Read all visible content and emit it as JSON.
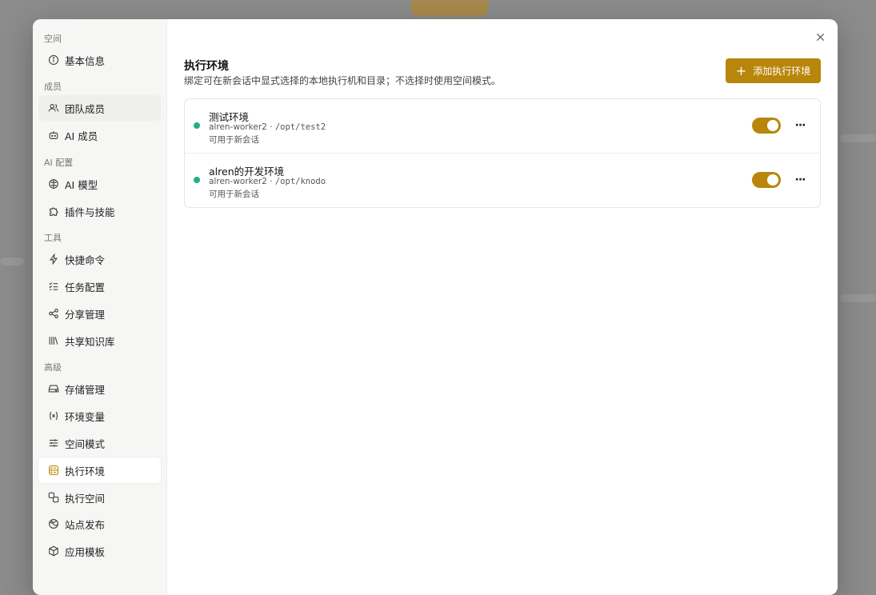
{
  "sidebar": {
    "groups": {
      "space": "空间",
      "members": "成员",
      "ai": "AI 配置",
      "tools": "工具",
      "advanced": "高级"
    },
    "items": {
      "basic_info": "基本信息",
      "team_members": "团队成员",
      "ai_members": "AI 成员",
      "ai_models": "AI 模型",
      "plugins_skills": "插件与技能",
      "shortcuts": "快捷命令",
      "task_config": "任务配置",
      "share_mgmt": "分享管理",
      "shared_kb": "共享知识库",
      "storage_mgmt": "存储管理",
      "env_vars": "环境变量",
      "space_mode": "空间模式",
      "exec_env": "执行环境",
      "exec_space": "执行空间",
      "site_publish": "站点发布",
      "app_templates": "应用模板"
    }
  },
  "main": {
    "title": "执行环境",
    "description": "绑定可在新会话中显式选择的本地执行机和目录；不选择时使用空间模式。",
    "add_button": "添加执行环境",
    "environments": [
      {
        "name": "测试环境",
        "worker": "alren-worker2",
        "separator": " · ",
        "path": "/opt/test2",
        "status": "可用于新会话",
        "enabled": true
      },
      {
        "name": "alren的开发环境",
        "worker": "alren-worker2",
        "separator": " · ",
        "path": "/opt/knodo",
        "status": "可用于新会话",
        "enabled": true
      }
    ]
  },
  "colors": {
    "accent": "#b8860b",
    "status_online": "#1fb37a"
  }
}
